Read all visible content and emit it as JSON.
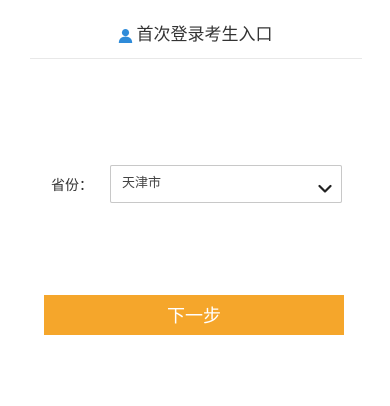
{
  "header": {
    "title": "首次登录考生入口",
    "icon": "user-icon",
    "icon_color": "#2e8bd9"
  },
  "form": {
    "province_label": "省份：",
    "province_value": "天津市",
    "dropdown_icon": "chevron-down-icon"
  },
  "actions": {
    "next_label": "下一步",
    "next_color": "#f5a62b"
  }
}
